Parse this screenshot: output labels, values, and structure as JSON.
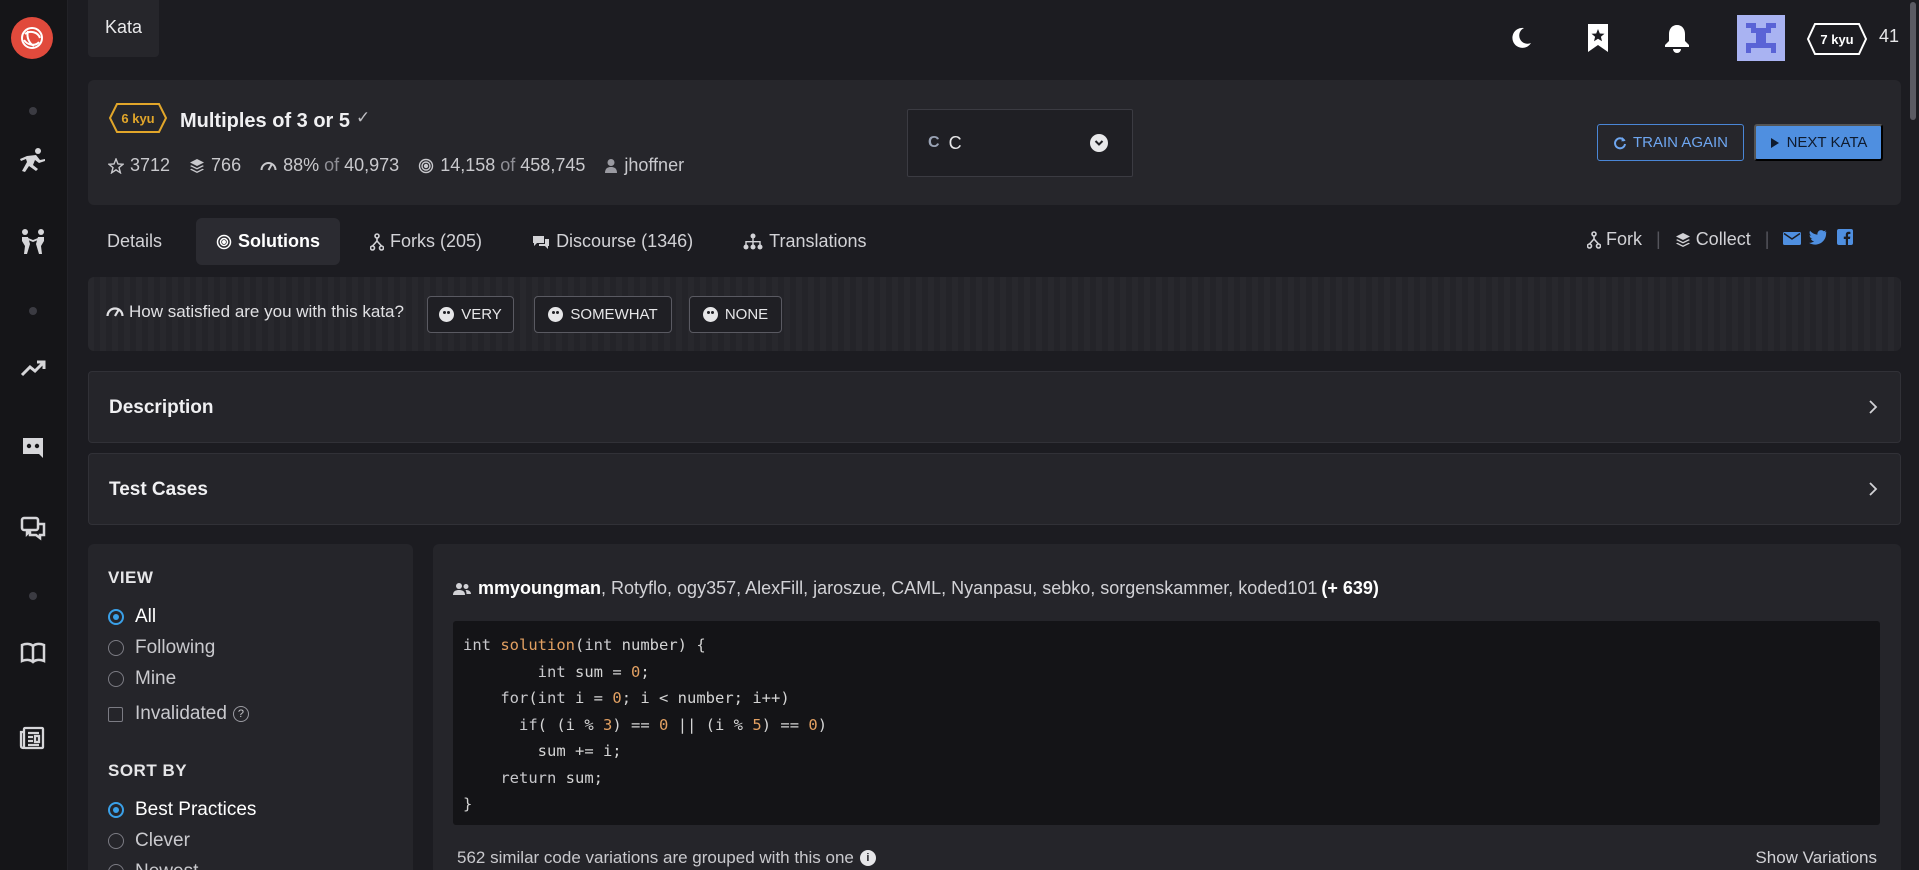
{
  "topbar": {
    "kata_tab": "Kata",
    "honor": "41",
    "rank": "7 kyu"
  },
  "kata": {
    "rank": "6 kyu",
    "title": "Multiples of 3 or 5",
    "stars": "3712",
    "collections": "766",
    "satisfaction_pct": "88%",
    "satisfaction_of": "of",
    "satisfaction_votes": "40,973",
    "completed": "14,158",
    "completed_of": "of",
    "attempts": "458,745",
    "author": "jhoffner"
  },
  "language": {
    "selected": "C"
  },
  "actions": {
    "train_again": "TRAIN AGAIN",
    "next_kata": "NEXT KATA"
  },
  "tabs": [
    {
      "label": "Details"
    },
    {
      "label": "Solutions"
    },
    {
      "label": "Forks (205)"
    },
    {
      "label": "Discourse (1346)"
    },
    {
      "label": "Translations"
    }
  ],
  "right_actions": {
    "fork": "Fork",
    "collect": "Collect"
  },
  "satisfaction": {
    "question": "How satisfied are you with this kata?",
    "very": "VERY",
    "somewhat": "SOMEWHAT",
    "none": "NONE"
  },
  "sections": {
    "description": "Description",
    "test_cases": "Test Cases"
  },
  "filters": {
    "view_title": "VIEW",
    "view_options": [
      "All",
      "Following",
      "Mine"
    ],
    "invalidated": "Invalidated",
    "sort_title": "SORT BY",
    "sort_options": [
      "Best Practices",
      "Clever",
      "Newest"
    ]
  },
  "solution": {
    "lead_author": "mmyoungman",
    "other_authors": ", Rotyflo, ogy357, AlexFill, jaroszue, CAML, Nyanpasu, sebko, sorgenskammer, koded101",
    "more": "(+ 639)",
    "variations_text": "562 similar code variations are grouped with this one",
    "show_variations": "Show Variations"
  },
  "colors": {
    "accent": "#4f8fe0",
    "brand": "#e14a3c",
    "rank6": "#e2a62a",
    "radio": "#3aa0e8"
  }
}
